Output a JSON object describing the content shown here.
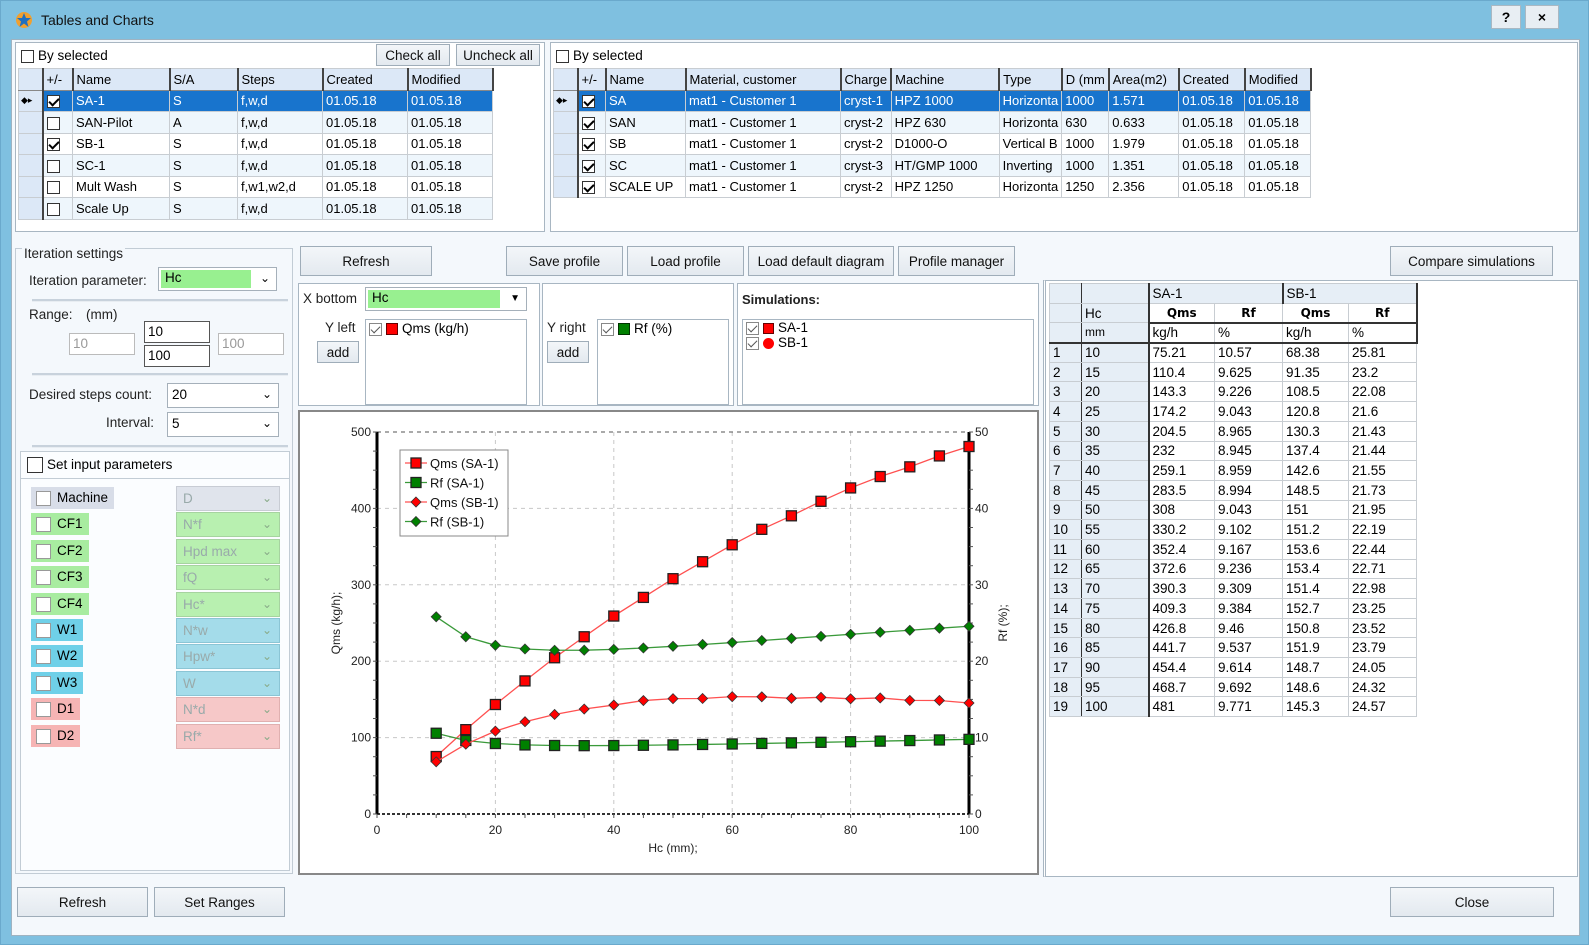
{
  "window": {
    "title": "Tables and Charts",
    "help_label": "?",
    "close_label": "×"
  },
  "projects_grid": {
    "by_selected_label": "By selected",
    "check_all_label": "Check all",
    "uncheck_all_label": "Uncheck all",
    "columns": [
      "+/-",
      "Name",
      "S/A",
      "Steps",
      "Created",
      "Modified"
    ],
    "rows": [
      {
        "checked": true,
        "name": "SA-1",
        "sa": "S",
        "steps": "f,w,d",
        "created": "01.05.18",
        "modified": "01.05.18",
        "selected": true
      },
      {
        "checked": false,
        "name": "SAN-Pilot",
        "sa": "A",
        "steps": "f,w,d",
        "created": "01.05.18",
        "modified": "01.05.18",
        "selected": false
      },
      {
        "checked": true,
        "name": "SB-1",
        "sa": "S",
        "steps": "f,w,d",
        "created": "01.05.18",
        "modified": "01.05.18",
        "selected": false
      },
      {
        "checked": false,
        "name": "SC-1",
        "sa": "S",
        "steps": "f,w,d",
        "created": "01.05.18",
        "modified": "01.05.18",
        "selected": false
      },
      {
        "checked": false,
        "name": "Mult Wash",
        "sa": "S",
        "steps": "f,w1,w2,d",
        "created": "01.05.18",
        "modified": "01.05.18",
        "selected": false
      },
      {
        "checked": false,
        "name": "Scale Up",
        "sa": "S",
        "steps": "f,w,d",
        "created": "01.05.18",
        "modified": "01.05.18",
        "selected": false
      }
    ]
  },
  "machines_grid": {
    "by_selected_label": "By selected",
    "columns": [
      "+/-",
      "Name",
      "Material, customer",
      "Charge",
      "Machine",
      "Type",
      "D (mm",
      "Area(m2)",
      "Created",
      "Modified"
    ],
    "rows": [
      {
        "checked": true,
        "name": "SA",
        "material": "mat1 - Customer 1",
        "charge": "cryst-1",
        "machine": "HPZ 1000",
        "type": "Horizonta",
        "d": "1000",
        "area": "1.571",
        "created": "01.05.18",
        "modified": "01.05.18",
        "selected": true
      },
      {
        "checked": true,
        "name": "SAN",
        "material": "mat1 - Customer 1",
        "charge": "cryst-2",
        "machine": "HPZ 630",
        "type": "Horizonta",
        "d": "630",
        "area": "0.633",
        "created": "01.05.18",
        "modified": "01.05.18",
        "selected": false
      },
      {
        "checked": true,
        "name": "SB",
        "material": "mat1 - Customer 1",
        "charge": "cryst-2",
        "machine": "D1000-O",
        "type": "Vertical B",
        "d": "1000",
        "area": "1.979",
        "created": "01.05.18",
        "modified": "01.05.18",
        "selected": false
      },
      {
        "checked": true,
        "name": "SC",
        "material": "mat1 - Customer 1",
        "charge": "cryst-3",
        "machine": "HT/GMP 1000",
        "type": "Inverting",
        "d": "1000",
        "area": "1.351",
        "created": "01.05.18",
        "modified": "01.05.18",
        "selected": false
      },
      {
        "checked": true,
        "name": "SCALE UP",
        "material": "mat1 - Customer 1",
        "charge": "cryst-2",
        "machine": "HPZ 1250",
        "type": "Horizonta",
        "d": "1250",
        "area": "2.356",
        "created": "01.05.18",
        "modified": "01.05.18",
        "selected": false
      }
    ]
  },
  "iteration": {
    "group_label": "Iteration settings",
    "param_label": "Iteration parameter:",
    "param_value": "Hc",
    "range_label": "Range:",
    "range_unit": "(mm)",
    "range_min_disabled": "10",
    "range_from": "10",
    "range_to": "100",
    "range_max_disabled": "100",
    "steps_label": "Desired steps count:",
    "steps_value": "20",
    "interval_label": "Interval:",
    "interval_value": "5"
  },
  "input_params": {
    "label": "Set input parameters",
    "items": [
      {
        "name": "Machine",
        "combo": "D",
        "color": "grey"
      },
      {
        "name": "CF1",
        "combo": "N*f",
        "color": "green"
      },
      {
        "name": "CF2",
        "combo": "Hpd max",
        "color": "green"
      },
      {
        "name": "CF3",
        "combo": "fQ",
        "color": "green"
      },
      {
        "name": "CF4",
        "combo": "Hc*",
        "color": "green"
      },
      {
        "name": "W1",
        "combo": "N*w",
        "color": "blue"
      },
      {
        "name": "W2",
        "combo": "Hpw*",
        "color": "blue"
      },
      {
        "name": "W3",
        "combo": "W",
        "color": "blue"
      },
      {
        "name": "D1",
        "combo": "N*d",
        "color": "pink"
      },
      {
        "name": "D2",
        "combo": "Rf*",
        "color": "pink"
      }
    ]
  },
  "toolbar": {
    "refresh_label": "Refresh",
    "save_profile_label": "Save profile",
    "load_profile_label": "Load profile",
    "load_default_label": "Load default diagram",
    "profile_manager_label": "Profile manager",
    "compare_label": "Compare simulations"
  },
  "axes_config": {
    "x_bottom_label": "X bottom",
    "x_bottom_value": "Hc",
    "y_left_label": "Y left",
    "y_left_item": "Qms (kg/h)",
    "y_right_label": "Y right",
    "y_right_item": "Rf (%)",
    "add_label": "add",
    "simulations_label": "Simulations:",
    "simulations": [
      "SA-1",
      "SB-1"
    ],
    "colors": {
      "red": "#ff0000",
      "green": "#008000"
    }
  },
  "footer": {
    "refresh_label": "Refresh",
    "set_ranges_label": "Set Ranges",
    "close_label": "Close"
  },
  "results_table": {
    "group_headers": [
      "SA-1",
      "SB-1"
    ],
    "param_header": "Hc",
    "param_unit": "mm",
    "columns": [
      "Qms",
      "Rf",
      "Qms",
      "Rf"
    ],
    "units": [
      "kg/h",
      "%",
      "kg/h",
      "%"
    ],
    "rows": [
      [
        "1",
        "10",
        "75.21",
        "10.57",
        "68.38",
        "25.81"
      ],
      [
        "2",
        "15",
        "110.4",
        "9.625",
        "91.35",
        "23.2"
      ],
      [
        "3",
        "20",
        "143.3",
        "9.226",
        "108.5",
        "22.08"
      ],
      [
        "4",
        "25",
        "174.2",
        "9.043",
        "120.8",
        "21.6"
      ],
      [
        "5",
        "30",
        "204.5",
        "8.965",
        "130.3",
        "21.43"
      ],
      [
        "6",
        "35",
        "232",
        "8.945",
        "137.4",
        "21.44"
      ],
      [
        "7",
        "40",
        "259.1",
        "8.959",
        "142.6",
        "21.55"
      ],
      [
        "8",
        "45",
        "283.5",
        "8.994",
        "148.5",
        "21.73"
      ],
      [
        "9",
        "50",
        "308",
        "9.043",
        "151",
        "21.95"
      ],
      [
        "10",
        "55",
        "330.2",
        "9.102",
        "151.2",
        "22.19"
      ],
      [
        "11",
        "60",
        "352.4",
        "9.167",
        "153.6",
        "22.44"
      ],
      [
        "12",
        "65",
        "372.6",
        "9.236",
        "153.4",
        "22.71"
      ],
      [
        "13",
        "70",
        "390.3",
        "9.309",
        "151.4",
        "22.98"
      ],
      [
        "14",
        "75",
        "409.3",
        "9.384",
        "152.7",
        "23.25"
      ],
      [
        "15",
        "80",
        "426.8",
        "9.46",
        "150.8",
        "23.52"
      ],
      [
        "16",
        "85",
        "441.7",
        "9.537",
        "151.9",
        "23.79"
      ],
      [
        "17",
        "90",
        "454.4",
        "9.614",
        "148.7",
        "24.05"
      ],
      [
        "18",
        "95",
        "468.7",
        "9.692",
        "148.6",
        "24.32"
      ],
      [
        "19",
        "100",
        "481",
        "9.771",
        "145.3",
        "24.57"
      ]
    ]
  },
  "chart_data": {
    "type": "line",
    "title": "",
    "xlabel": "Hc (mm);",
    "ylabel": "Qms (kg/h);",
    "y2label": "Rf (%);",
    "xlim": [
      0,
      100
    ],
    "ylim": [
      0,
      500
    ],
    "y2lim": [
      0,
      50
    ],
    "xticks": [
      0,
      20,
      40,
      60,
      80,
      100
    ],
    "yticks": [
      0,
      100,
      200,
      300,
      400,
      500
    ],
    "y2ticks": [
      0,
      10,
      20,
      30,
      40,
      50
    ],
    "grid": true,
    "legend_position": "top-left",
    "x": [
      10,
      15,
      20,
      25,
      30,
      35,
      40,
      45,
      50,
      55,
      60,
      65,
      70,
      75,
      80,
      85,
      90,
      95,
      100
    ],
    "series": [
      {
        "name": "Qms  (SA-1)",
        "axis": "left",
        "color": "#ff0000",
        "marker": "square",
        "values": [
          75.21,
          110.4,
          143.3,
          174.2,
          204.5,
          232,
          259.1,
          283.5,
          308,
          330.2,
          352.4,
          372.6,
          390.3,
          409.3,
          426.8,
          441.7,
          454.4,
          468.7,
          481
        ]
      },
      {
        "name": "Rf  (SA-1)",
        "axis": "right",
        "color": "#008000",
        "marker": "square",
        "values": [
          10.57,
          9.625,
          9.226,
          9.043,
          8.965,
          8.945,
          8.959,
          8.994,
          9.043,
          9.102,
          9.167,
          9.236,
          9.309,
          9.384,
          9.46,
          9.537,
          9.614,
          9.692,
          9.771
        ]
      },
      {
        "name": "Qms  (SB-1)",
        "axis": "left",
        "color": "#ff0000",
        "marker": "diamond",
        "values": [
          68.38,
          91.35,
          108.5,
          120.8,
          130.3,
          137.4,
          142.6,
          148.5,
          151,
          151.2,
          153.6,
          153.4,
          151.4,
          152.7,
          150.8,
          151.9,
          148.7,
          148.6,
          145.3
        ]
      },
      {
        "name": "Rf  (SB-1)",
        "axis": "right",
        "color": "#008000",
        "marker": "diamond",
        "values": [
          25.81,
          23.2,
          22.08,
          21.6,
          21.43,
          21.44,
          21.55,
          21.73,
          21.95,
          22.19,
          22.44,
          22.71,
          22.98,
          23.25,
          23.52,
          23.79,
          24.05,
          24.32,
          24.57
        ]
      }
    ]
  }
}
